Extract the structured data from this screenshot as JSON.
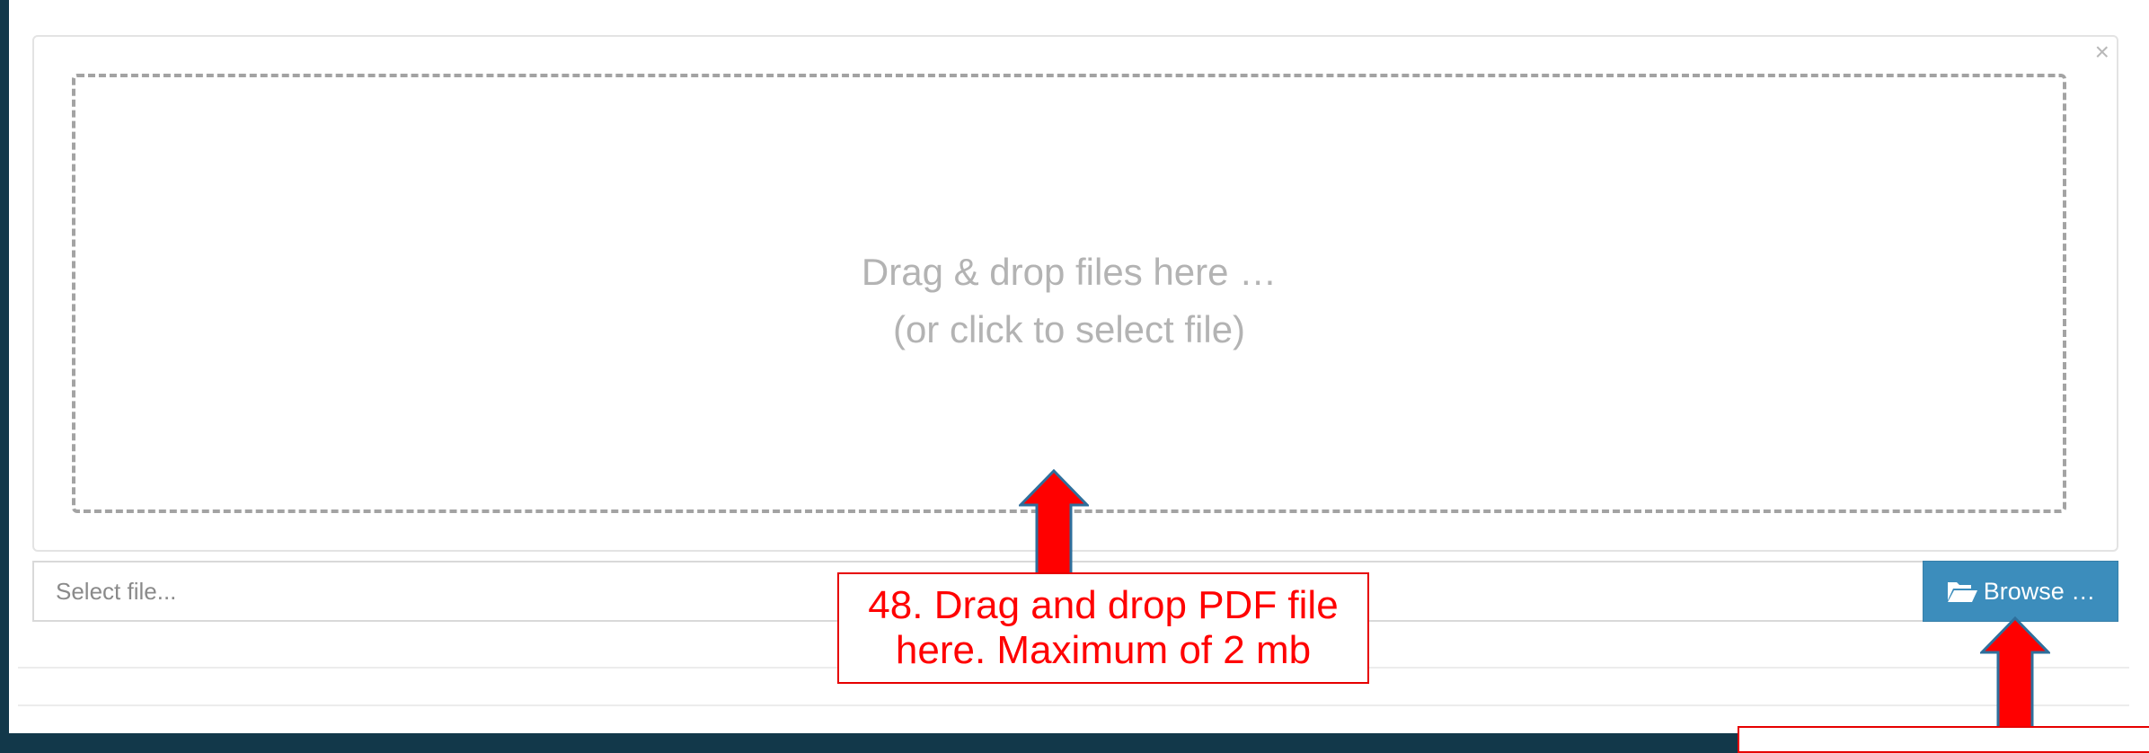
{
  "uploader": {
    "drop_zone": {
      "line1": "Drag & drop files here …",
      "line2": "(or click to select file)"
    },
    "close_label": "×",
    "file_input_placeholder": "Select file...",
    "browse_label": "Browse …"
  },
  "annotations": {
    "callout_48": {
      "line1": "48. Drag and drop PDF file",
      "line2": "here. Maximum of 2 mb"
    }
  },
  "colors": {
    "accent": "#3c8dbc",
    "annotation": "#ff0000",
    "background": "#12384a"
  },
  "icons": {
    "browse": "folder-open-icon",
    "close": "close-icon"
  }
}
